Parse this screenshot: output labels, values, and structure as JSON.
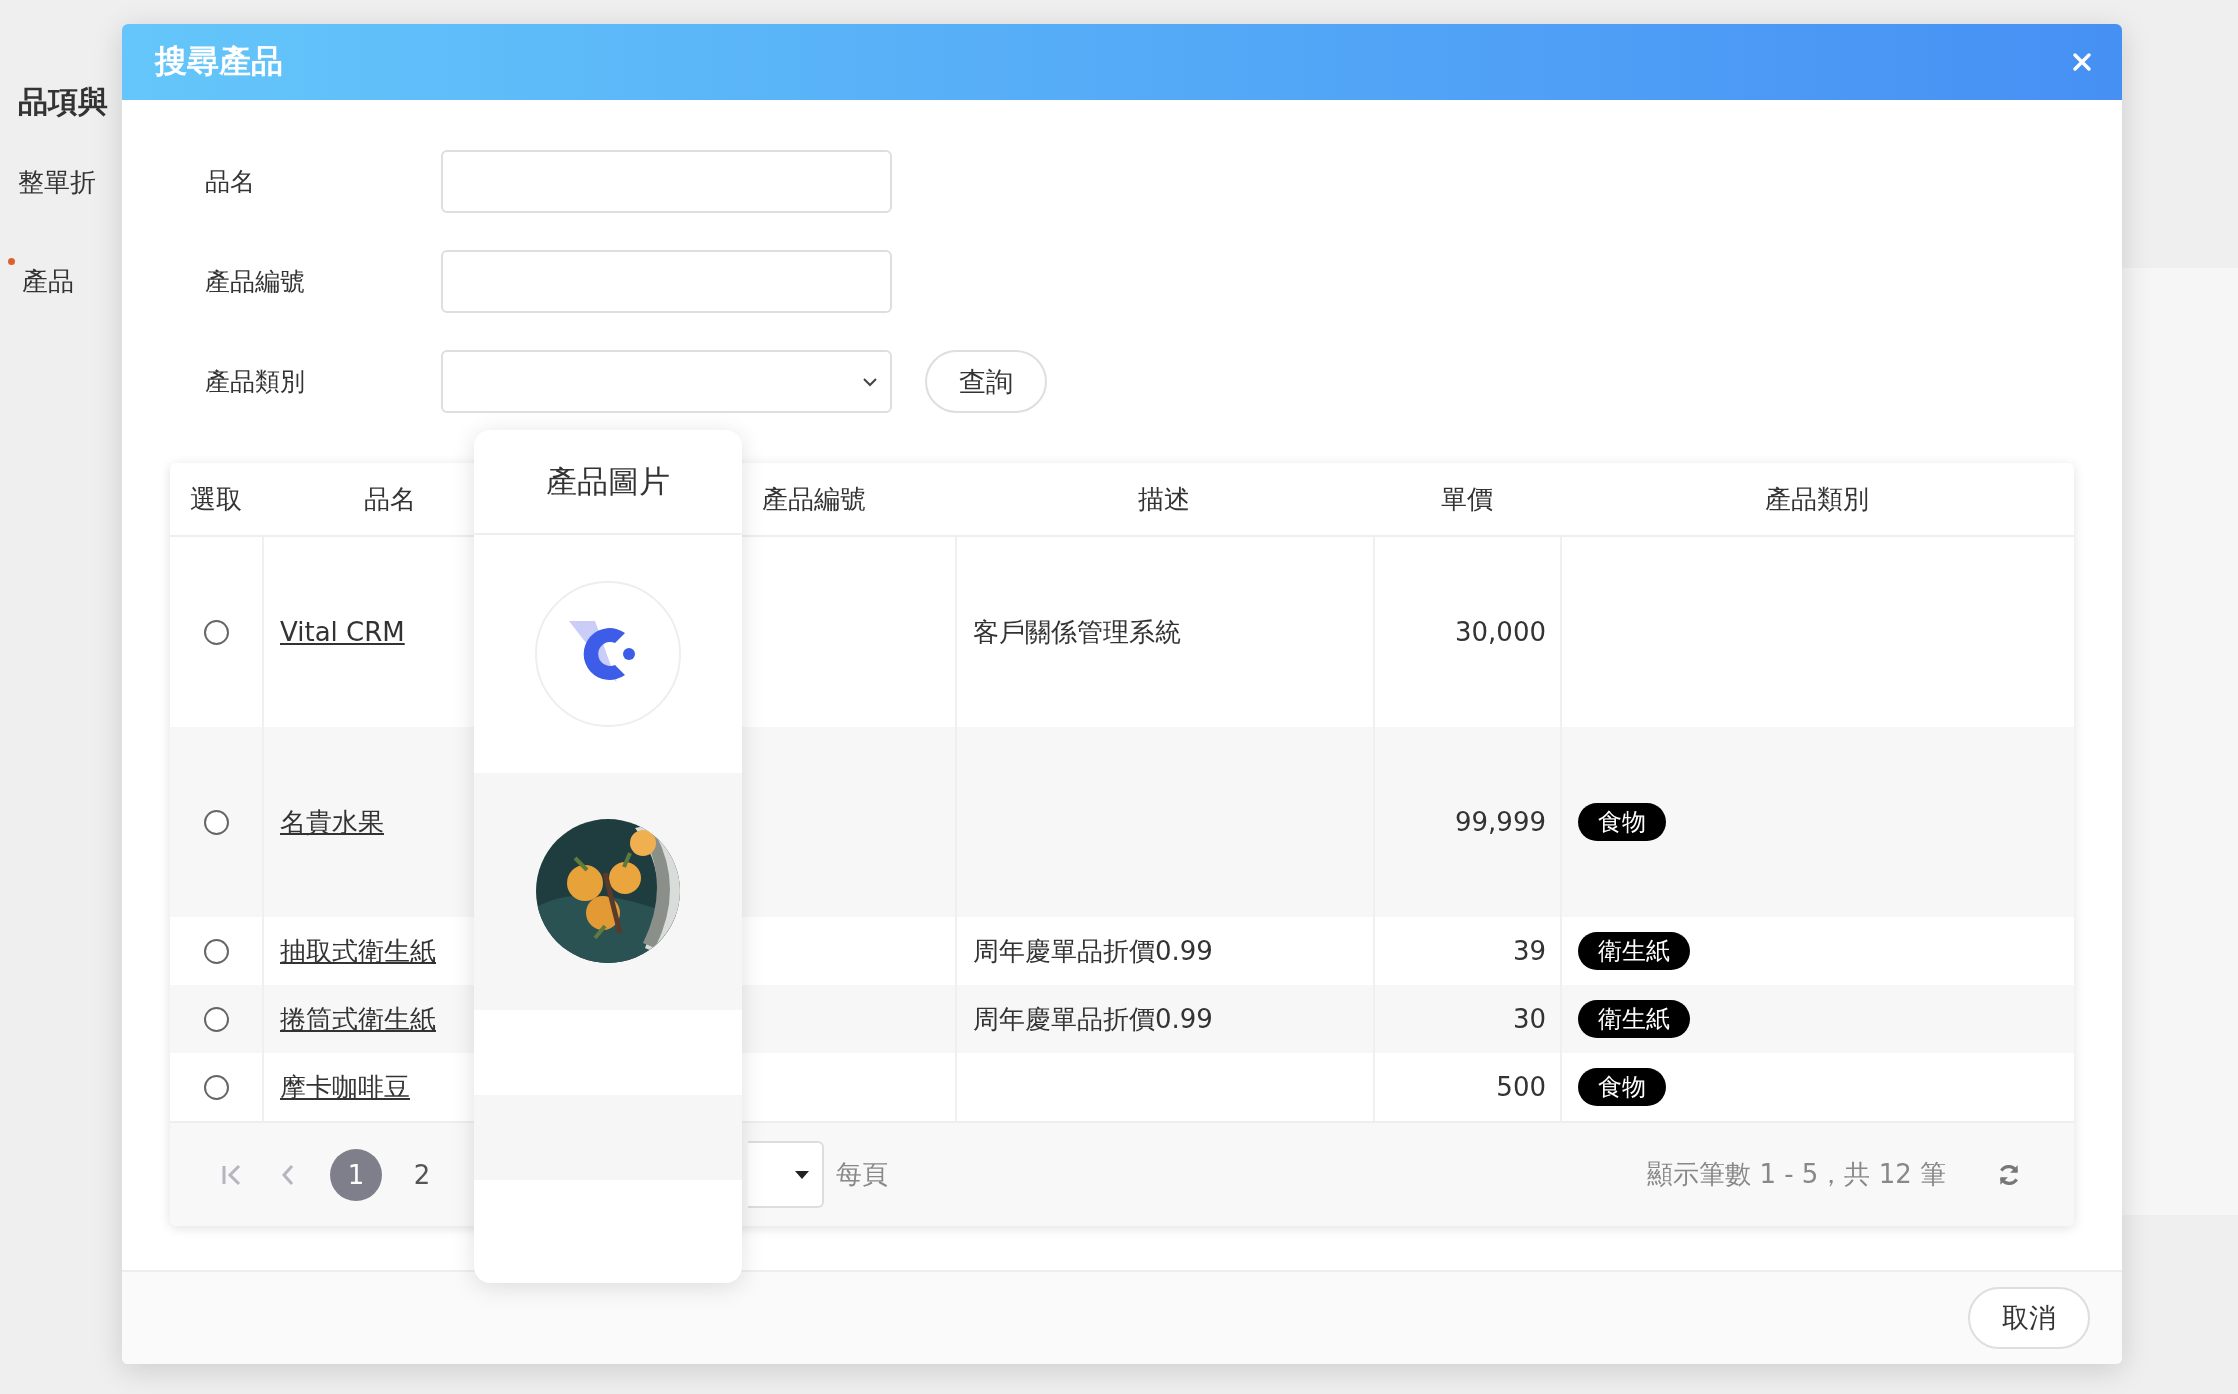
{
  "background": {
    "heading": "品項與",
    "labels": [
      {
        "text": "整單折",
        "required": false
      },
      {
        "text": "產品",
        "required": true
      }
    ]
  },
  "modal": {
    "title": "搜尋產品",
    "form": {
      "fields": [
        {
          "label": "品名",
          "kind": "text"
        },
        {
          "label": "產品編號",
          "kind": "text"
        },
        {
          "label": "產品類別",
          "kind": "select"
        }
      ],
      "query_button": "查詢"
    },
    "table": {
      "columns": [
        "選取",
        "品名",
        "產品編號",
        "描述",
        "單價",
        "產品類別"
      ],
      "dragged_column": {
        "label": "產品圖片"
      },
      "rows": [
        {
          "selected": false,
          "name": "Vital CRM",
          "description": "客戶關係管理系統",
          "price": "30,000",
          "image": {
            "kind": "logo"
          }
        },
        {
          "selected": false,
          "name": "名貴水果",
          "price": "99,999",
          "category": "食物"
        },
        {
          "selected": false,
          "name": "抽取式衛生紙",
          "description": "周年慶單品折價0.99",
          "price": "39",
          "category": "衛生紙"
        },
        {
          "selected": false,
          "name": "捲筒式衛生紙",
          "description": "周年慶單品折價0.99",
          "price": "30",
          "category": "衛生紙"
        },
        {
          "selected": false,
          "name": "摩卡咖啡豆",
          "price": "500",
          "category": "食物"
        }
      ],
      "pagination": {
        "pages": [
          {
            "label": "1",
            "selected": true
          },
          {
            "label": "2",
            "selected": false
          }
        ],
        "per_page_label": "每頁",
        "summary": "顯示筆數 1 - 5，共 12 筆"
      }
    },
    "footer": {
      "cancel_button": "取消"
    }
  }
}
